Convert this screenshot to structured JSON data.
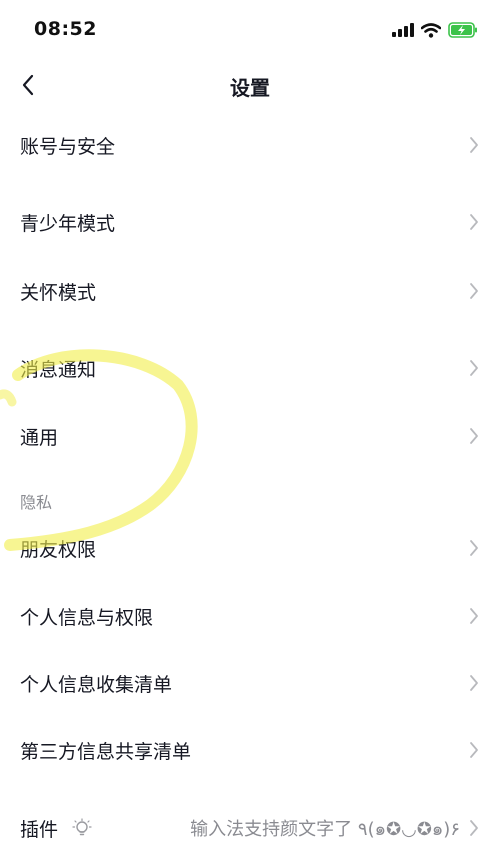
{
  "status": {
    "time": "08:52"
  },
  "nav": {
    "title": "设置"
  },
  "rows": {
    "account_security": "账号与安全",
    "teen_mode": "青少年模式",
    "care_mode": "关怀模式",
    "notifications": "消息通知",
    "general": "通用",
    "friend_permissions": "朋友权限",
    "personal_info_permissions": "个人信息与权限",
    "personal_info_list": "个人信息收集清单",
    "third_party_list": "第三方信息共享清单",
    "plugins": "插件"
  },
  "privacy_section_header": "隐私",
  "plugin_hint": "输入法支持颜文字了 ٩(๑✪◡✪๑)۶",
  "colors": {
    "text": "#161823",
    "secondary": "#8a8b91",
    "chevron": "#b8b9bd",
    "battery": "#3cc34a",
    "highlight": "#f2ee4a"
  }
}
